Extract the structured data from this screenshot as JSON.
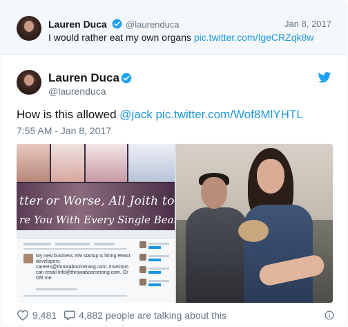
{
  "quoted_tweet": {
    "author_name": "Lauren Duca",
    "handle": "@laurenduca",
    "date": "Jan 8, 2017",
    "text": "I would rather eat my own organs",
    "link": "pic.twitter.com/IgeCRZqk8w"
  },
  "tweet": {
    "author_name": "Lauren Duca",
    "handle": "@laurenduca",
    "text_prefix": "How is this allowed",
    "mention": "@jack",
    "link": "pic.twitter.com/Wof8MlYHTL",
    "timestamp": "7:55 AM - Jan 8, 2017"
  },
  "media": {
    "left_image": {
      "overlay_line1": "tter or Worse, All Joith to Part,",
      "overlay_line2": "re You With Every Single Beat of my",
      "inner_tweet_text": "My new business SW startup is hiring React developers: careers@throwaboomerang.com. Investors can email info@throwaboomerang.com. Or DM me."
    }
  },
  "footer": {
    "likes": "9,481",
    "talking": "4,882 people are talking about this"
  },
  "colors": {
    "link": "#1b95e0",
    "muted": "#657786",
    "text": "#14171a",
    "quoted_bg": "#f5f8fa"
  },
  "icons": {
    "verified": "verified-badge-icon",
    "bird": "twitter-bird-icon",
    "heart": "heart-icon",
    "reply": "reply-bubble-icon",
    "info": "info-icon"
  }
}
